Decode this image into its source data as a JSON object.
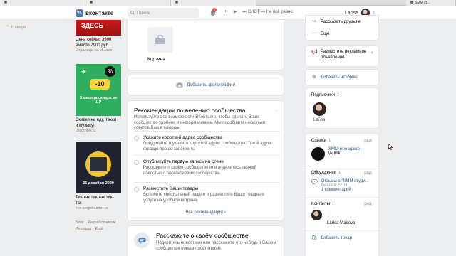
{
  "browser": {
    "tab_right": "SMM ст..."
  },
  "header": {
    "logo_text": "вконтакте",
    "logo_mark": "VK",
    "search_placeholder": "Поиск",
    "notifications_count": "1",
    "track_text": "СЛОТ — Не всё равно",
    "user_name": "Larisa"
  },
  "left_nav": {
    "back_label": "Наверх"
  },
  "ads": [
    {
      "banner": "ЗДЕСЬ",
      "title": "Цена сейчас 3900 вместо 7900 руб.",
      "source": "Страница на vk.com"
    },
    {
      "pill": "-10",
      "pct": "%",
      "caption": "3 месяца скидок за 1 ₽",
      "title": "Скидки на еду, такси и музыку!",
      "source": "vkcombo.ru"
    },
    {
      "date": "25 декабря 2020",
      "title": "Тик-так тик-так тик-так",
      "source": "live.targethunter.ru"
    }
  ],
  "footer_links": [
    "Блог",
    "Разработчикам",
    "Реклама",
    "Ещё"
  ],
  "goods": {
    "label": "Корзина"
  },
  "add_photos": "Добавить фотографии",
  "recommendations": {
    "title": "Рекомендации по ведению сообщества",
    "description": "Используйте все возможности ВКонтакте, чтобы сделать Ваше сообщество удобнее и информативнее. Мы подобрали несколько советов Вам в помощь.",
    "items": [
      {
        "title": "Укажите короткий адрес сообщества",
        "text": "Придумайте и укажите короткий адрес сообщества. Такой адрес гораздо проще запомнить."
      },
      {
        "title": "Опубликуйте первую запись на стене",
        "text": "Расскажите о своём сообществе или поделитесь свежей новостью с посетителями сообщества."
      },
      {
        "title": "Разместите Ваши товары",
        "text": "Включите специальный раздел и разместите Ваши товары и услуги на удобной витрине."
      }
    ],
    "all_label": "Все рекомендации"
  },
  "tell": {
    "title": "Расскажите о своём сообществе",
    "text": "Поделитесь новостями или расскажите что-нибудь о Вашем сообществе новым посетителям."
  },
  "right": {
    "tell_friends": "Рассказать друзьям",
    "more": "Ещё",
    "ad_text": "Разместить рекламное объявление",
    "add_story": "Добавить историю",
    "subscribers": {
      "title": "Подписчики",
      "count": "1",
      "name": "Larisa"
    },
    "links": {
      "title": "Ссылки",
      "count": "1",
      "edit": "ред.",
      "name": "SMM менеджер",
      "url": "vk.link"
    },
    "discussions": {
      "title": "Обсуждения",
      "count": "1",
      "edit": "ред.",
      "topic": "Отзывы о \"SMM студи...",
      "time": "вчера в 22:11",
      "comments": "1 комментарий"
    },
    "contacts": {
      "title": "Контакты",
      "count": "1",
      "edit": "ред.",
      "name": "Larisa Vlasova"
    },
    "add_product": "Добавить товар"
  }
}
